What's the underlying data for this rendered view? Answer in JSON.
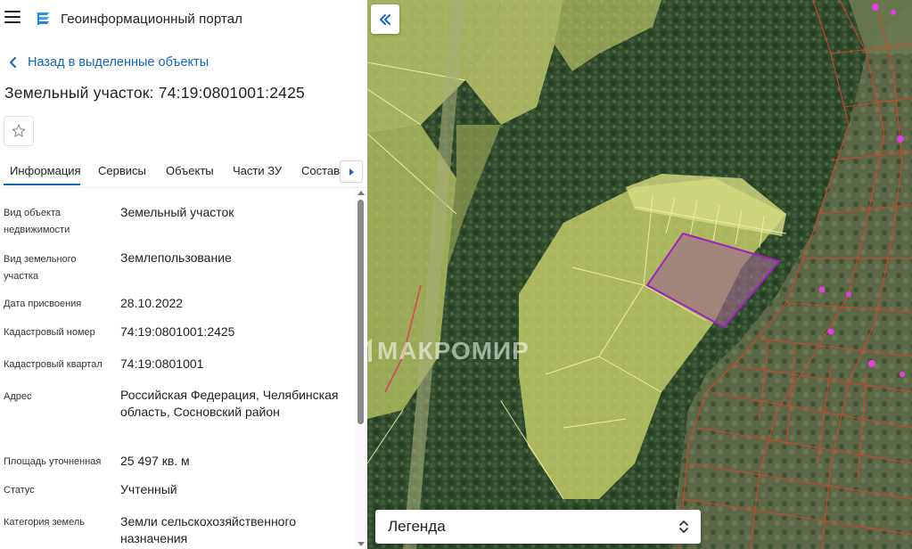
{
  "app": {
    "title": "Геоинформационный портал"
  },
  "navigation": {
    "back_label": "Назад в выделенные объекты"
  },
  "object": {
    "title": "Земельный участок: 74:19:0801001:2425"
  },
  "tabs": [
    {
      "label": "Информация",
      "active": true
    },
    {
      "label": "Сервисы",
      "active": false
    },
    {
      "label": "Объекты",
      "active": false
    },
    {
      "label": "Части ЗУ",
      "active": false
    },
    {
      "label": "Состав",
      "active": false
    }
  ],
  "properties": [
    {
      "label": "Вид объекта недвижимости",
      "value": "Земельный участок"
    },
    {
      "label": "Вид земельного участка",
      "value": "Землепользование"
    },
    {
      "label": "Дата присвоения",
      "value": "28.10.2022"
    },
    {
      "label": "Кадастровый номер",
      "value": "74:19:0801001:2425"
    },
    {
      "label": "Кадастровый квартал",
      "value": "74:19:0801001"
    },
    {
      "label": "Адрес",
      "value": "Российская Федерация, Челябинская область, Сосновский район"
    },
    {
      "label": "Площадь уточненная",
      "value": "25 497 кв. м"
    },
    {
      "label": "Статус",
      "value": "Учтенный"
    },
    {
      "label": "Категория земель",
      "value": "Земли сельскохозяйственного назначения"
    }
  ],
  "map": {
    "watermark": "МАКРОМИР",
    "legend_label": "Легенда"
  },
  "icons": {
    "menu": "menu-icon",
    "logo": "portal-logo-icon",
    "back": "chevron-left-icon",
    "favorite": "star-outline-icon",
    "tabs_next": "caret-right-icon",
    "collapse": "double-chevron-left-icon",
    "legend_toggle": "unfold-icon"
  },
  "colors": {
    "accent": "#1565c0",
    "cadastral_overlay": "#e8e26a",
    "selected_parcel": "#a020a0",
    "parcel_border_red": "#e0402a"
  }
}
